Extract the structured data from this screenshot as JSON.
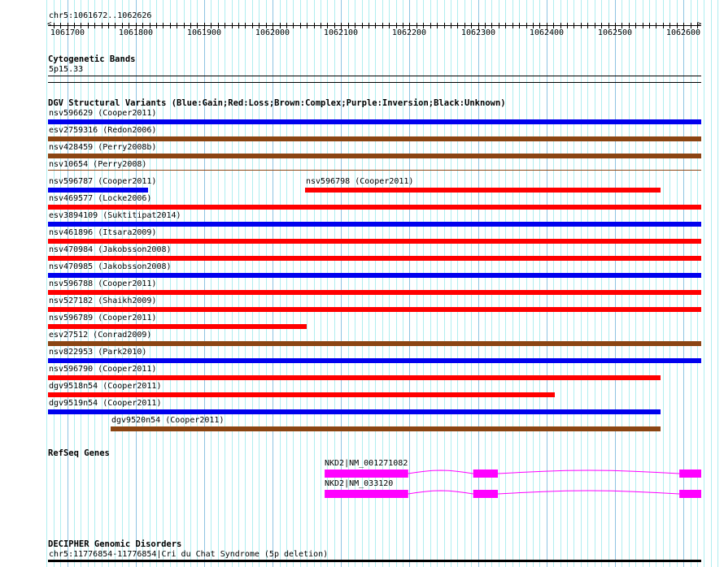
{
  "view": {
    "chrom": "chr5",
    "start": 1061672,
    "end": 1062626,
    "location_label": "chr5:1061672..1062626"
  },
  "ruler": {
    "tick_labels": [
      "1061700",
      "1061800",
      "1061900",
      "1062000",
      "1062100",
      "1062200",
      "1062300",
      "1062400",
      "1062500",
      "1062600"
    ]
  },
  "colors": {
    "gain": "#0000ee",
    "loss": "#ff0000",
    "complex": "#8b4513",
    "inversion": "#800080",
    "unknown": "#000000",
    "gene": "#ff00ff",
    "grid_minor": "#b0eef0",
    "grid_major": "#8ec4e2"
  },
  "tracks": {
    "cyto": {
      "title": "Cytogenetic Bands",
      "band": "5p15.33"
    },
    "dgv": {
      "title": "DGV Structural Variants (Blue:Gain;Red:Loss;Brown:Complex;Purple:Inversion;Black:Unknown)",
      "rows": [
        [
          {
            "label": "nsv596629 (Cooper2011)",
            "type": "gain",
            "start": 1061672,
            "end": 1062626
          }
        ],
        [
          {
            "label": "esv2759316 (Redon2006)",
            "type": "complex",
            "start": 1061672,
            "end": 1062626
          }
        ],
        [
          {
            "label": "nsv428459 (Perry2008b)",
            "type": "complex",
            "start": 1061672,
            "end": 1062626
          }
        ],
        [
          {
            "label": "nsv10654 (Perry2008)",
            "type": "complex",
            "start": 1061672,
            "end": 1062626,
            "thin": true
          }
        ],
        [
          {
            "label": "nsv596787 (Cooper2011)",
            "type": "gain",
            "start": 1061672,
            "end": 1061818
          },
          {
            "label": "nsv596798 (Cooper2011)",
            "type": "loss",
            "start": 1062047,
            "end": 1062567
          }
        ],
        [
          {
            "label": "nsv469577 (Locke2006)",
            "type": "loss",
            "start": 1061672,
            "end": 1062626
          }
        ],
        [
          {
            "label": "esv3894109 (Suktitipat2014)",
            "type": "gain",
            "start": 1061672,
            "end": 1062626
          }
        ],
        [
          {
            "label": "nsv461896 (Itsara2009)",
            "type": "loss",
            "start": 1061672,
            "end": 1062626
          }
        ],
        [
          {
            "label": "nsv470984 (Jakobsson2008)",
            "type": "loss",
            "start": 1061672,
            "end": 1062626
          }
        ],
        [
          {
            "label": "nsv470985 (Jakobsson2008)",
            "type": "gain",
            "start": 1061672,
            "end": 1062626
          }
        ],
        [
          {
            "label": "nsv596788 (Cooper2011)",
            "type": "loss",
            "start": 1061672,
            "end": 1062626
          }
        ],
        [
          {
            "label": "nsv527182 (Shaikh2009)",
            "type": "loss",
            "start": 1061672,
            "end": 1062626
          }
        ],
        [
          {
            "label": "nsv596789 (Cooper2011)",
            "type": "loss",
            "start": 1061672,
            "end": 1062050
          }
        ],
        [
          {
            "label": "esv27512 (Conrad2009)",
            "type": "complex",
            "start": 1061672,
            "end": 1062626
          }
        ],
        [
          {
            "label": "nsv822953 (Park2010)",
            "type": "gain",
            "start": 1061672,
            "end": 1062626
          }
        ],
        [
          {
            "label": "nsv596790 (Cooper2011)",
            "type": "loss",
            "start": 1061672,
            "end": 1062567
          }
        ],
        [
          {
            "label": "dgv9518n54 (Cooper2011)",
            "type": "loss",
            "start": 1061672,
            "end": 1062412
          }
        ],
        [
          {
            "label": "dgv9519n54 (Cooper2011)",
            "type": "gain",
            "start": 1061672,
            "end": 1062567
          }
        ],
        [
          {
            "label": "dgv9520n54 (Cooper2011)",
            "type": "complex",
            "start": 1061763,
            "end": 1062567
          }
        ]
      ]
    },
    "refseq": {
      "title": "RefSeq Genes",
      "transcripts": [
        {
          "label": "NKD2|NM_001271082",
          "exons": [
            [
              1062076,
              1062198
            ],
            [
              1062293,
              1062329
            ],
            [
              1062594,
              1062626
            ]
          ]
        },
        {
          "label": "NKD2|NM_033120",
          "exons": [
            [
              1062076,
              1062198
            ],
            [
              1062293,
              1062329
            ],
            [
              1062594,
              1062626
            ]
          ]
        }
      ]
    },
    "decipher": {
      "title": "DECIPHER Genomic Disorders",
      "feature": "chr5:11776854-11776854|Cri du Chat Syndrome (5p deletion)"
    }
  }
}
